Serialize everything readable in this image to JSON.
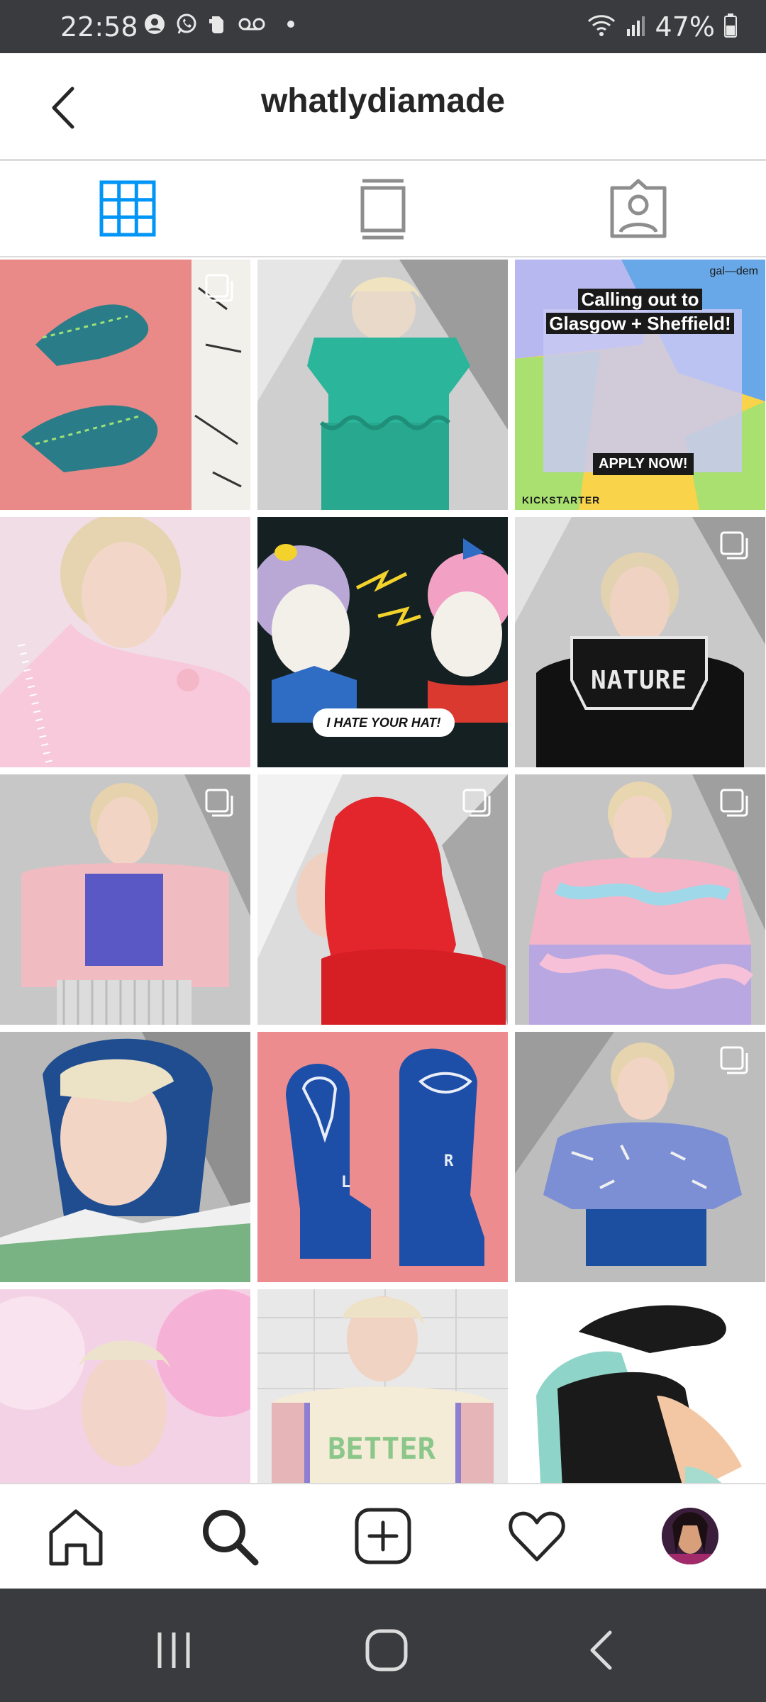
{
  "status_bar": {
    "time": "22:58",
    "battery": "47%",
    "icons": [
      "account-icon",
      "whatsapp-icon",
      "evernote-icon",
      "voicemail-icon",
      "dot-icon",
      "wifi-icon",
      "signal-icon",
      "battery-icon"
    ]
  },
  "header": {
    "title": "whatlydiamade",
    "back_icon": "chevron-left-icon"
  },
  "tabs": [
    {
      "name": "grid",
      "icon": "grid-icon",
      "active": true
    },
    {
      "name": "feed",
      "icon": "feed-icon",
      "active": false
    },
    {
      "name": "tagged",
      "icon": "tagged-icon",
      "active": false
    }
  ],
  "posts": [
    {
      "subject": "knitted socks",
      "multi": true
    },
    {
      "subject": "green knit set",
      "multi": false
    },
    {
      "subject": "gal-dem kickstarter",
      "multi": false,
      "kickstarter": {
        "brand_tag": "gal—dem",
        "title_line1": "Calling out to",
        "title_line2": "Glasgow + Sheffield!",
        "apply": "APPLY NOW!",
        "sponsor": "KICKSTARTER"
      }
    },
    {
      "subject": "pink tulle portrait",
      "multi": false
    },
    {
      "subject": "clown illustration",
      "multi": false,
      "speech": "I HATE YOUR HAT!"
    },
    {
      "subject": "nature jumper",
      "multi": true,
      "text": "NATURE"
    },
    {
      "subject": "pink cardigan",
      "multi": true
    },
    {
      "subject": "red hood",
      "multi": true
    },
    {
      "subject": "pastel outfit",
      "multi": true
    },
    {
      "subject": "blue balaclava",
      "multi": false
    },
    {
      "subject": "blue mittens",
      "multi": false,
      "left_letter": "L",
      "right_letter": "R"
    },
    {
      "subject": "speckled jumper",
      "multi": true
    },
    {
      "subject": "pink balloons",
      "multi": false
    },
    {
      "subject": "better vest",
      "multi": false,
      "text": "BETTER"
    },
    {
      "subject": "cowboy illustration",
      "multi": false
    }
  ],
  "bottom_nav": [
    {
      "name": "home",
      "icon": "home-icon"
    },
    {
      "name": "search",
      "icon": "search-icon",
      "active": true
    },
    {
      "name": "new-post",
      "icon": "add-post-icon"
    },
    {
      "name": "activity",
      "icon": "heart-icon"
    },
    {
      "name": "profile",
      "icon": "avatar-icon"
    }
  ],
  "system_nav": [
    {
      "name": "recents",
      "icon": "recents-icon"
    },
    {
      "name": "home",
      "icon": "home-circle-icon"
    },
    {
      "name": "back",
      "icon": "back-icon"
    }
  ],
  "colors": {
    "accent_blue": "#0095f6",
    "icon_dark": "#262626",
    "icon_grey": "#8e8e8e",
    "status_bar_bg": "#3a3b3f"
  }
}
